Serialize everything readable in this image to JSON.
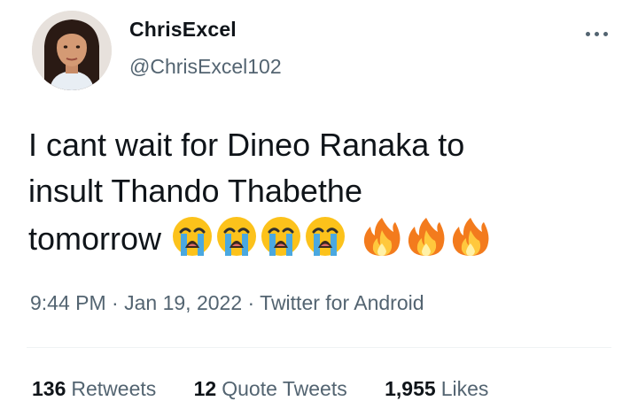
{
  "author": {
    "display_name": "ChrisExcel",
    "handle": "@ChrisExcel102"
  },
  "tweet": {
    "lines": [
      "I cant wait for Dineo Ranaka to",
      "insult Thando Thabethe",
      "tomorrow"
    ],
    "emoji": [
      "loudly-crying-face",
      "loudly-crying-face",
      "loudly-crying-face",
      "loudly-crying-face",
      "fire",
      "fire",
      "fire"
    ]
  },
  "meta": {
    "time": "9:44 PM",
    "sep1": "·",
    "date": "Jan 19, 2022",
    "sep2": "·",
    "source": "Twitter for Android"
  },
  "stats": {
    "retweets_count": "136",
    "retweets_label": "Retweets",
    "quotes_count": "12",
    "quotes_label": "Quote Tweets",
    "likes_count": "1,955",
    "likes_label": "Likes"
  },
  "colors": {
    "text": "#0f1419",
    "secondary": "#536471",
    "divider": "#eff3f4"
  }
}
